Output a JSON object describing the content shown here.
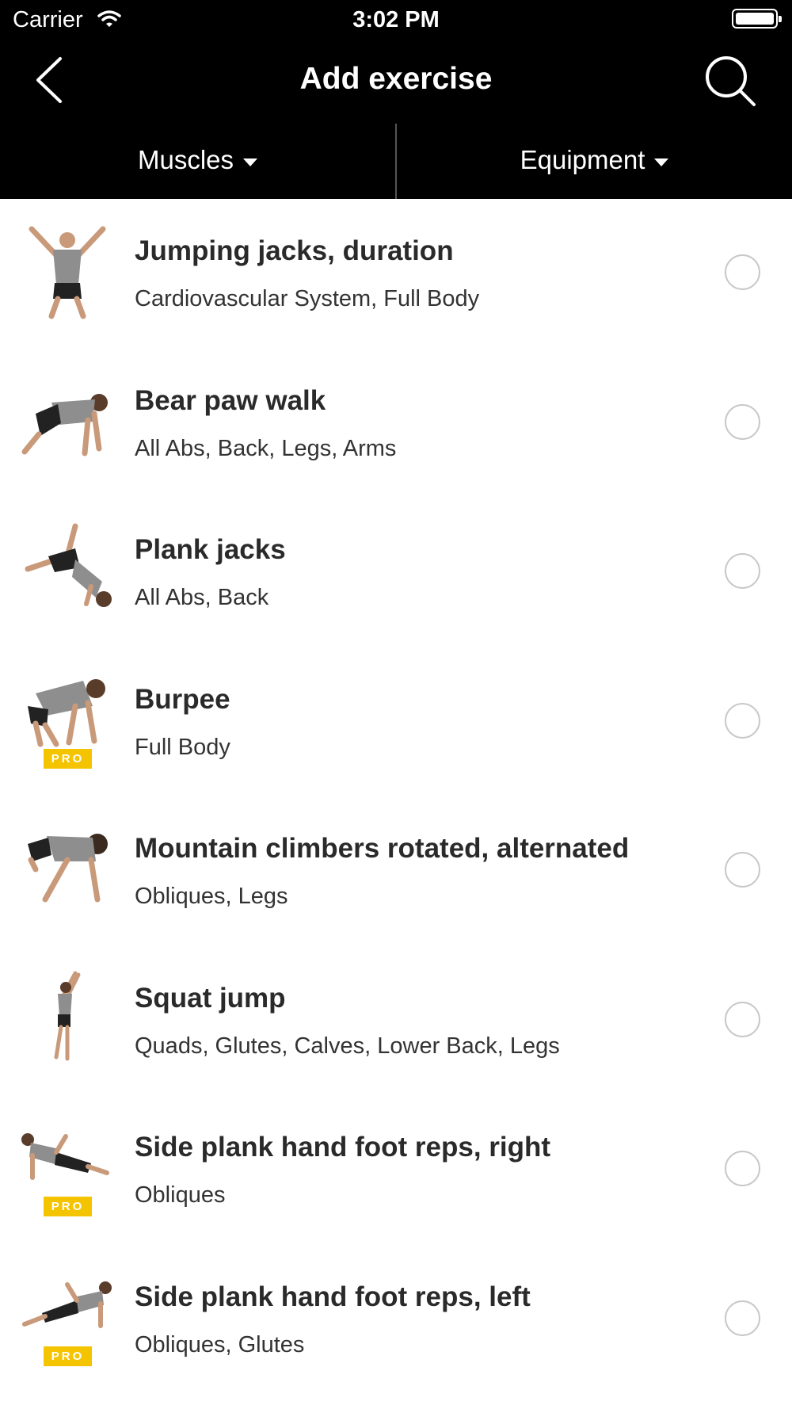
{
  "status": {
    "carrier": "Carrier",
    "time": "3:02 PM"
  },
  "nav": {
    "title": "Add exercise",
    "back_icon": "chevron-left-icon",
    "search_icon": "search-icon"
  },
  "filters": {
    "muscles": "Muscles",
    "equipment": "Equipment"
  },
  "pro_label": "PRO",
  "exercises": [
    {
      "name": "Jumping jacks, duration",
      "muscles": "Cardiovascular System, Full Body",
      "pro": false
    },
    {
      "name": "Bear paw walk",
      "muscles": "All Abs, Back, Legs, Arms",
      "pro": false
    },
    {
      "name": "Plank jacks",
      "muscles": "All Abs, Back",
      "pro": false
    },
    {
      "name": "Burpee",
      "muscles": "Full Body",
      "pro": true
    },
    {
      "name": "Mountain climbers rotated, alternated",
      "muscles": "Obliques, Legs",
      "pro": false
    },
    {
      "name": "Squat jump",
      "muscles": "Quads, Glutes, Calves, Lower Back, Legs",
      "pro": false
    },
    {
      "name": "Side plank hand foot reps, right",
      "muscles": "Obliques",
      "pro": true
    },
    {
      "name": "Side plank hand foot reps, left",
      "muscles": "Obliques, Glutes",
      "pro": true
    }
  ],
  "colors": {
    "bar": "#000000",
    "pro_badge": "#f5c400",
    "radio_border": "#c8c8c8"
  }
}
